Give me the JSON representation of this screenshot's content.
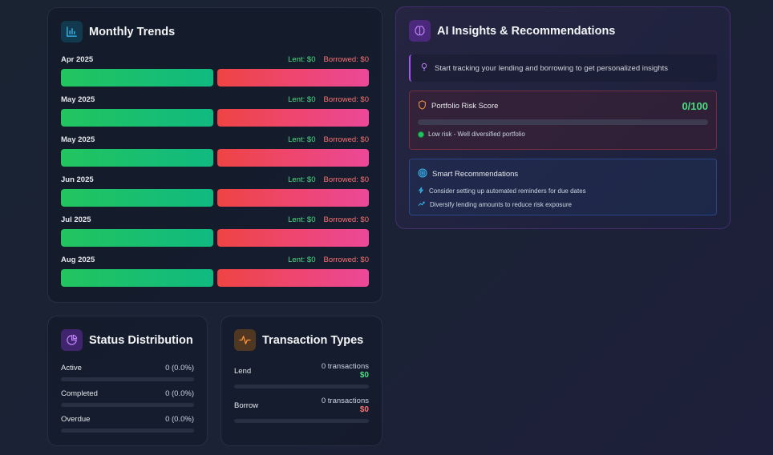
{
  "monthly_trends": {
    "title": "Monthly Trends",
    "icon": "bar-chart-icon",
    "rows": [
      {
        "month": "Apr 2025",
        "lent": "Lent: $0",
        "borrowed": "Borrowed: $0"
      },
      {
        "month": "May 2025",
        "lent": "Lent: $0",
        "borrowed": "Borrowed: $0"
      },
      {
        "month": "May 2025",
        "lent": "Lent: $0",
        "borrowed": "Borrowed: $0"
      },
      {
        "month": "Jun 2025",
        "lent": "Lent: $0",
        "borrowed": "Borrowed: $0"
      },
      {
        "month": "Jul 2025",
        "lent": "Lent: $0",
        "borrowed": "Borrowed: $0"
      },
      {
        "month": "Aug 2025",
        "lent": "Lent: $0",
        "borrowed": "Borrowed: $0"
      }
    ],
    "colors": {
      "lent": "#22c55e",
      "borrowed": "#ef4444"
    }
  },
  "ai_insights": {
    "title": "AI Insights & Recommendations",
    "icon": "brain-icon",
    "tip": "Start tracking your lending and borrowing to get personalized insights",
    "risk": {
      "label": "Portfolio Risk Score",
      "score": "0/100",
      "level": 0,
      "note": "Low risk - Well diversified portfolio"
    },
    "recommendations": {
      "title": "Smart Recommendations",
      "items": [
        "Consider setting up automated reminders for due dates",
        "Diversify lending amounts to reduce risk exposure"
      ]
    }
  },
  "status_distribution": {
    "title": "Status Distribution",
    "icon": "pie-chart-icon",
    "rows": [
      {
        "label": "Active",
        "value": "0 (0.0%)",
        "fraction": 0
      },
      {
        "label": "Completed",
        "value": "0 (0.0%)",
        "fraction": 0
      },
      {
        "label": "Overdue",
        "value": "0 (0.0%)",
        "fraction": 0
      }
    ]
  },
  "transaction_types": {
    "title": "Transaction Types",
    "icon": "activity-icon",
    "rows": [
      {
        "label": "Lend",
        "count": "0 transactions",
        "amount": "$0",
        "fraction": 0
      },
      {
        "label": "Borrow",
        "count": "0 transactions",
        "amount": "$0",
        "fraction": 0
      }
    ]
  }
}
